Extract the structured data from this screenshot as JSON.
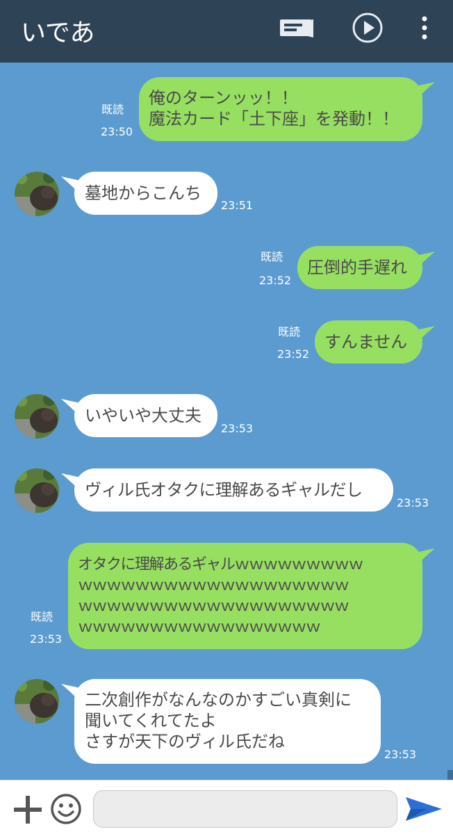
{
  "header": {
    "title": "いであ",
    "icons": [
      "notes-icon",
      "play-icon",
      "more-icon"
    ],
    "background": "#2f4356"
  },
  "chat": {
    "background": "#5b9bd0",
    "bubble_colors": {
      "mine": "#97df61",
      "theirs": "#ffffff"
    },
    "messages": [
      {
        "from": "me",
        "text": "俺のターンッッ！！\n魔法カード「土下座」を発動！！",
        "read": "既読",
        "time": "23:50"
      },
      {
        "from": "them",
        "text": "墓地からこんち",
        "time": "23:51"
      },
      {
        "from": "me",
        "text": "圧倒的手遅れ",
        "read": "既読",
        "time": "23:52"
      },
      {
        "from": "me",
        "text": "すんません",
        "read": "既読",
        "time": "23:52"
      },
      {
        "from": "them",
        "text": "いやいや大丈夫",
        "time": "23:53"
      },
      {
        "from": "them",
        "text": "ヴィル氏オタクに理解あるギャルだし",
        "time": "23:53"
      },
      {
        "from": "me",
        "text": "オタクに理解あるギャルｗｗｗｗｗｗｗｗｗ\nｗｗｗｗｗｗｗｗｗｗｗｗｗｗｗｗｗｗｗ\nｗｗｗｗｗｗｗｗｗｗｗｗｗｗｗｗｗｗｗ\nｗｗｗｗｗｗｗｗｗｗｗｗｗｗｗｗｗ",
        "read": "既読",
        "time": "23:53"
      },
      {
        "from": "them",
        "text": "二次創作がなんなのかすごい真剣に\n聞いてくれてたよ\nさすが天下のヴィル氏だね",
        "time": "23:53"
      }
    ]
  },
  "input": {
    "placeholder": "",
    "value": ""
  },
  "footer_icons": [
    "plus-icon",
    "emoji-icon",
    "send-icon"
  ]
}
